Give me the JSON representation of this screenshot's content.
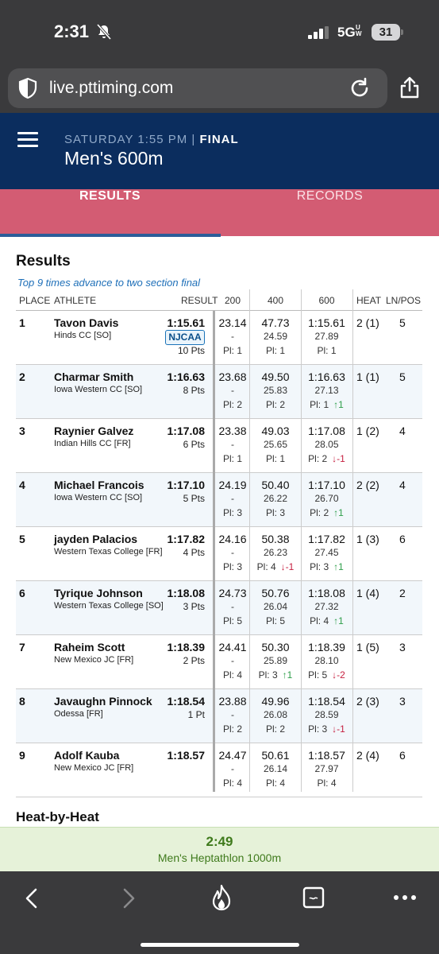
{
  "status": {
    "time": "2:31",
    "network": "5G",
    "network_sup": "UW",
    "battery": "31"
  },
  "browser": {
    "url": "live.pttiming.com"
  },
  "event": {
    "day": "SATURDAY",
    "time": "1:55 PM",
    "separator": "|",
    "round": "FINAL",
    "title": "Men's 600m"
  },
  "tabs": [
    "RESULTS",
    "RECORDS"
  ],
  "results": {
    "heading": "Results",
    "note": "Top 9 times advance to two section final",
    "columns": {
      "place": "PLACE",
      "athlete": "ATHLETE",
      "result": "RESULT",
      "s200": "200",
      "s400": "400",
      "s600": "600",
      "heat": "HEAT",
      "lnpos": "LN/POS"
    },
    "rows": [
      {
        "place": "1",
        "name": "Tavon Davis",
        "team": "Hinds CC [SO]",
        "result": "1:15.61",
        "badge": "NJCAA",
        "pts": "10 Pts",
        "s200": {
          "time": "23.14",
          "split": "-",
          "pl": "Pl: 1",
          "change": ""
        },
        "s400": {
          "time": "47.73",
          "split": "24.59",
          "pl": "Pl: 1",
          "change": ""
        },
        "s600": {
          "time": "1:15.61",
          "split": "27.89",
          "pl": "Pl: 1",
          "change": ""
        },
        "heat": "2 (1)",
        "lnpos": "5"
      },
      {
        "place": "2",
        "name": "Charmar Smith",
        "team": "Iowa Western CC [SO]",
        "result": "1:16.63",
        "badge": "",
        "pts": "8 Pts",
        "s200": {
          "time": "23.68",
          "split": "-",
          "pl": "Pl: 2",
          "change": ""
        },
        "s400": {
          "time": "49.50",
          "split": "25.83",
          "pl": "Pl: 2",
          "change": ""
        },
        "s600": {
          "time": "1:16.63",
          "split": "27.13",
          "pl": "Pl: 1",
          "change": "↑1"
        },
        "heat": "1 (1)",
        "lnpos": "5"
      },
      {
        "place": "3",
        "name": "Raynier Galvez",
        "team": "Indian Hills CC [FR]",
        "result": "1:17.08",
        "badge": "",
        "pts": "6 Pts",
        "s200": {
          "time": "23.38",
          "split": "-",
          "pl": "Pl: 1",
          "change": ""
        },
        "s400": {
          "time": "49.03",
          "split": "25.65",
          "pl": "Pl: 1",
          "change": ""
        },
        "s600": {
          "time": "1:17.08",
          "split": "28.05",
          "pl": "Pl: 2",
          "change": "↓-1"
        },
        "heat": "1 (2)",
        "lnpos": "4"
      },
      {
        "place": "4",
        "name": "Michael Francois",
        "team": "Iowa Western CC [SO]",
        "result": "1:17.10",
        "badge": "",
        "pts": "5 Pts",
        "s200": {
          "time": "24.19",
          "split": "-",
          "pl": "Pl: 3",
          "change": ""
        },
        "s400": {
          "time": "50.40",
          "split": "26.22",
          "pl": "Pl: 3",
          "change": ""
        },
        "s600": {
          "time": "1:17.10",
          "split": "26.70",
          "pl": "Pl: 2",
          "change": "↑1"
        },
        "heat": "2 (2)",
        "lnpos": "4"
      },
      {
        "place": "5",
        "name": "jayden Palacios",
        "team": "Western Texas College [FR]",
        "result": "1:17.82",
        "badge": "",
        "pts": "4 Pts",
        "s200": {
          "time": "24.16",
          "split": "-",
          "pl": "Pl: 3",
          "change": ""
        },
        "s400": {
          "time": "50.38",
          "split": "26.23",
          "pl": "Pl: 4",
          "change": "↓-1"
        },
        "s600": {
          "time": "1:17.82",
          "split": "27.45",
          "pl": "Pl: 3",
          "change": "↑1"
        },
        "heat": "1 (3)",
        "lnpos": "6"
      },
      {
        "place": "6",
        "name": "Tyrique Johnson",
        "team": "Western Texas College [SO]",
        "result": "1:18.08",
        "badge": "",
        "pts": "3 Pts",
        "s200": {
          "time": "24.73",
          "split": "-",
          "pl": "Pl: 5",
          "change": ""
        },
        "s400": {
          "time": "50.76",
          "split": "26.04",
          "pl": "Pl: 5",
          "change": ""
        },
        "s600": {
          "time": "1:18.08",
          "split": "27.32",
          "pl": "Pl: 4",
          "change": "↑1"
        },
        "heat": "1 (4)",
        "lnpos": "2"
      },
      {
        "place": "7",
        "name": "Raheim Scott",
        "team": "New Mexico JC [FR]",
        "result": "1:18.39",
        "badge": "",
        "pts": "2 Pts",
        "s200": {
          "time": "24.41",
          "split": "-",
          "pl": "Pl: 4",
          "change": ""
        },
        "s400": {
          "time": "50.30",
          "split": "25.89",
          "pl": "Pl: 3",
          "change": "↑1"
        },
        "s600": {
          "time": "1:18.39",
          "split": "28.10",
          "pl": "Pl: 5",
          "change": "↓-2"
        },
        "heat": "1 (5)",
        "lnpos": "3"
      },
      {
        "place": "8",
        "name": "Javaughn Pinnock",
        "team": "Odessa [FR]",
        "result": "1:18.54",
        "badge": "",
        "pts": "1 Pt",
        "s200": {
          "time": "23.88",
          "split": "-",
          "pl": "Pl: 2",
          "change": ""
        },
        "s400": {
          "time": "49.96",
          "split": "26.08",
          "pl": "Pl: 2",
          "change": ""
        },
        "s600": {
          "time": "1:18.54",
          "split": "28.59",
          "pl": "Pl: 3",
          "change": "↓-1"
        },
        "heat": "2 (3)",
        "lnpos": "3"
      },
      {
        "place": "9",
        "name": "Adolf Kauba",
        "team": "New Mexico JC [FR]",
        "result": "1:18.57",
        "badge": "",
        "pts": "",
        "s200": {
          "time": "24.47",
          "split": "-",
          "pl": "Pl: 4",
          "change": ""
        },
        "s400": {
          "time": "50.61",
          "split": "26.14",
          "pl": "Pl: 4",
          "change": ""
        },
        "s600": {
          "time": "1:18.57",
          "split": "27.97",
          "pl": "Pl: 4",
          "change": ""
        },
        "heat": "2 (4)",
        "lnpos": "6"
      }
    ]
  },
  "heat_heading": "Heat-by-Heat",
  "next_event": {
    "time": "2:49",
    "name": "Men's Heptathlon 1000m"
  },
  "colors": {
    "header": "#0b2d5e",
    "tabs": "#d35c73",
    "up": "#2e9e4a",
    "down": "#c62040",
    "next_bar": "#e6f2d9"
  },
  "icons": [
    "bell-slash-icon",
    "signal-icon",
    "shield-icon",
    "reload-icon",
    "share-icon",
    "menu-icon",
    "back-icon",
    "forward-icon",
    "flame-icon",
    "tabs-icon",
    "more-icon"
  ]
}
